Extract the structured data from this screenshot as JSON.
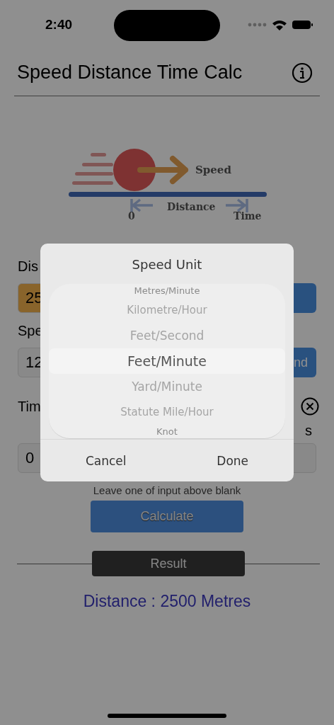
{
  "status_bar": {
    "time": "2:40"
  },
  "header": {
    "title": "Speed Distance Time Calc"
  },
  "illustration": {
    "speed_label": "Speed",
    "distance_label": "Distance",
    "start_label": "0",
    "time_label": "Time"
  },
  "form": {
    "distance": {
      "label": "Dis",
      "value": "25"
    },
    "speed": {
      "label": "Spe",
      "value": "12",
      "unit_button": "nd"
    },
    "time": {
      "label": "Tim",
      "unit_label": "s",
      "value": "0"
    },
    "hint": "Leave one of input above blank",
    "calculate": "Calculate"
  },
  "result": {
    "heading": "Result",
    "text": "Distance : 2500 Metres"
  },
  "picker_dialog": {
    "title": "Speed Unit",
    "options": [
      {
        "label": "Metres/Minute",
        "selected": false
      },
      {
        "label": "Kilometre/Hour",
        "selected": false
      },
      {
        "label": "Feet/Second",
        "selected": false
      },
      {
        "label": "Feet/Minute",
        "selected": true
      },
      {
        "label": "Yard/Minute",
        "selected": false
      },
      {
        "label": "Statute Mile/Hour",
        "selected": false
      },
      {
        "label": "Knot",
        "selected": false
      }
    ],
    "cancel": "Cancel",
    "done": "Done"
  }
}
